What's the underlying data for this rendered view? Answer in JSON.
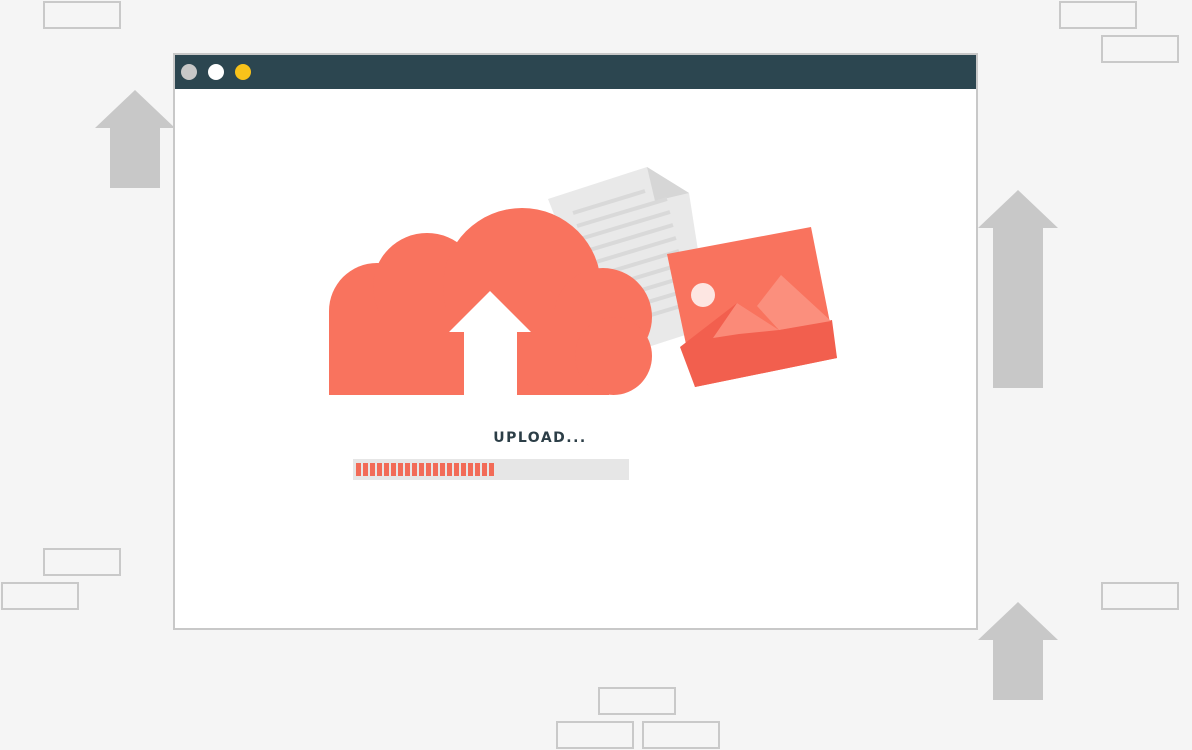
{
  "upload": {
    "status_text": "UPLOAD...",
    "progress_percent": 53,
    "progress_segments_filled": 20
  },
  "window": {
    "controls": [
      {
        "name": "grey",
        "color": "#c8c8c8"
      },
      {
        "name": "white",
        "color": "#ffffff"
      },
      {
        "name": "yellow",
        "color": "#f8c21a"
      }
    ]
  },
  "icons": {
    "cloud": "cloud-upload-icon",
    "document": "document-icon",
    "image": "image-icon",
    "decor_arrow": "up-arrow-icon"
  },
  "colors": {
    "accent": "#f9735e",
    "accent_dark": "#f26b57",
    "titlebar": "#2c4650",
    "decor": "#c8c8c8",
    "background": "#f5f5f5"
  }
}
